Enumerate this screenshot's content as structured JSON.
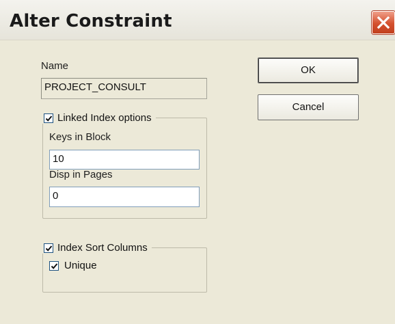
{
  "window": {
    "title": "Alter Constraint"
  },
  "name_section": {
    "label": "Name",
    "value": "PROJECT_CONSULT"
  },
  "buttons": {
    "ok_label": "OK",
    "cancel_label": "Cancel"
  },
  "linked_index": {
    "legend": "Linked Index options",
    "checked": true,
    "keys_label": "Keys in Block",
    "keys_value": "10",
    "disp_label": "Disp in Pages",
    "disp_value": "0"
  },
  "index_sort": {
    "legend": "Index Sort Columns",
    "checked": true,
    "unique_label": "Unique",
    "unique_checked": true
  },
  "colors": {
    "dialog_bg": "#ece9d8",
    "close_red": "#d4502e",
    "field_border": "#7f9db9"
  },
  "icons": {
    "close": "close-icon",
    "check": "check-icon"
  }
}
